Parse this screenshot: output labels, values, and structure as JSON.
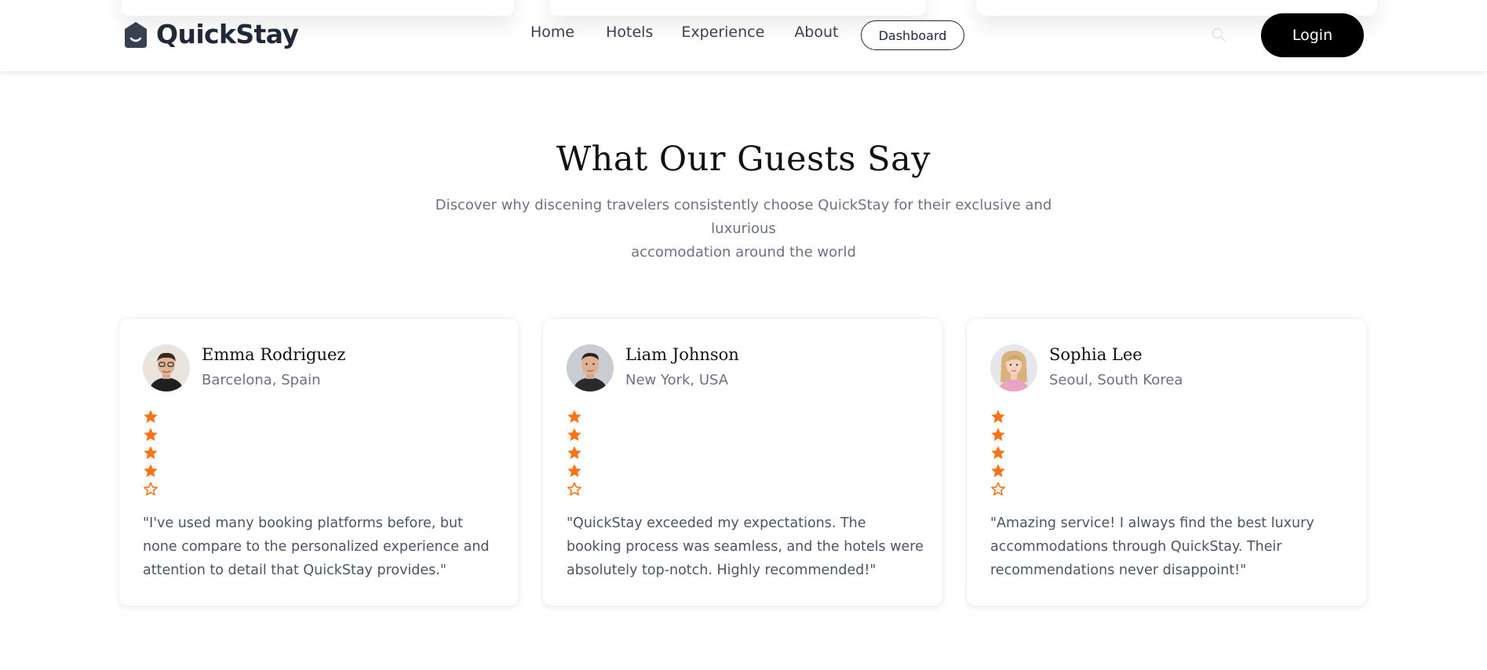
{
  "brand": {
    "name": "QuickStay",
    "logo_icon": "house-smile-icon"
  },
  "nav": {
    "links": [
      "Home",
      "Hotels",
      "Experience",
      "About"
    ],
    "dashboard_label": "Dashboard",
    "search_icon": "search-icon",
    "login_label": "Login"
  },
  "section": {
    "title": "What Our Guests Say",
    "subtitle_line1": "Discover why discening travelers consistently choose QuickStay for their exclusive and luxurious",
    "subtitle_line2": "accomodation around the world"
  },
  "testimonials": [
    {
      "name": "Emma Rodriguez",
      "location": "Barcelona, Spain",
      "rating": 4,
      "max_rating": 5,
      "review": "\"I've used many booking platforms before, but none compare to the personalized experience and attention to detail that QuickStay provides.\""
    },
    {
      "name": "Liam Johnson",
      "location": "New York, USA",
      "rating": 4,
      "max_rating": 5,
      "review": "\"QuickStay exceeded my expectations. The booking process was seamless, and the hotels were absolutely top-notch. Highly recommended!\""
    },
    {
      "name": "Sophia Lee",
      "location": "Seoul, South Korea",
      "rating": 4,
      "max_rating": 5,
      "review": "\"Amazing service! I always find the best luxury accommodations through QuickStay. Their recommendations never disappoint!\""
    }
  ],
  "colors": {
    "star": "#f97316",
    "login_bg": "#000000",
    "text_muted": "#6b7280"
  }
}
